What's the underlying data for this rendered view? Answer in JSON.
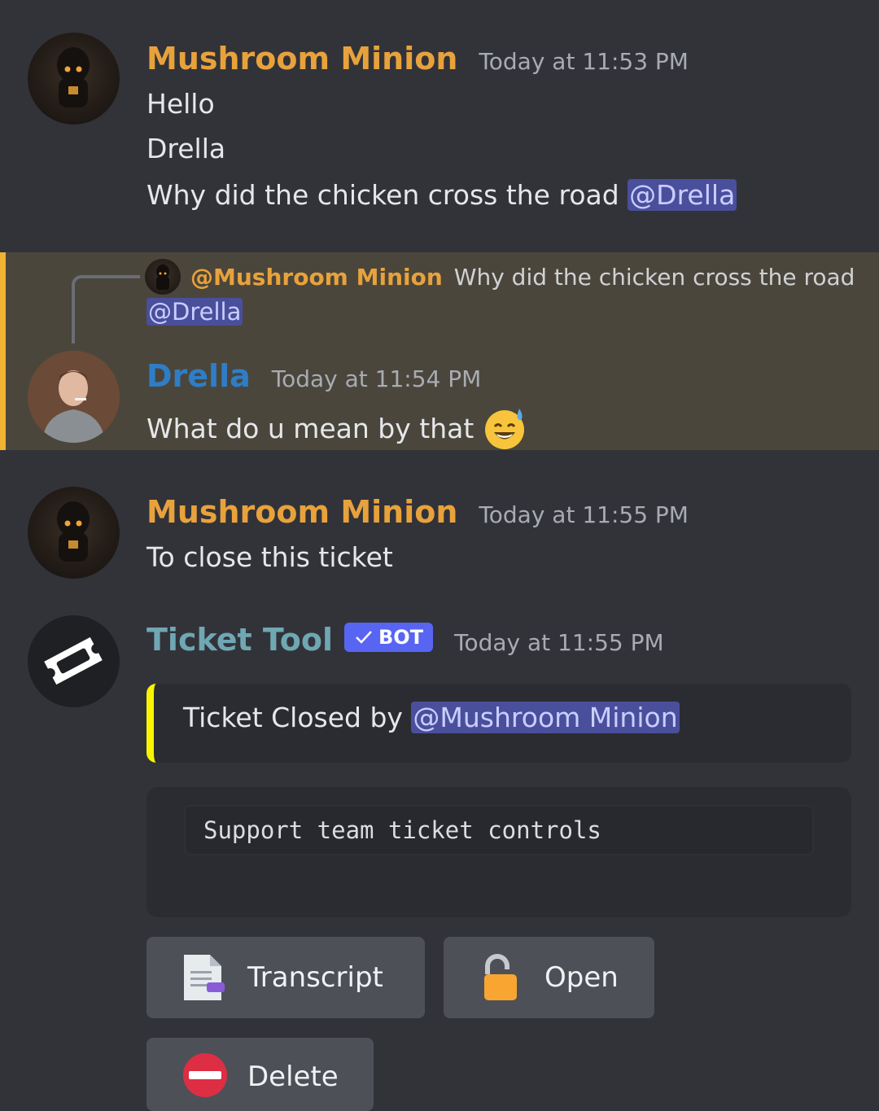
{
  "messages": [
    {
      "author": "Mushroom Minion",
      "timestamp": "Today at 11:53 PM",
      "lines": [
        "Hello",
        "Drella",
        "Why did the chicken cross the road "
      ],
      "mention": "@Drella"
    },
    {
      "reply": {
        "author": "@Mushroom Minion",
        "text": "Why did the chicken cross the road",
        "mention": "@Drella"
      },
      "author": "Drella",
      "timestamp": "Today at 11:54 PM",
      "text": "What do u mean by that",
      "emoji": "😅"
    },
    {
      "author": "Mushroom Minion",
      "timestamp": "Today at 11:55 PM",
      "text": "To close this ticket"
    },
    {
      "author": "Ticket Tool",
      "badge": "BOT",
      "timestamp": "Today at 11:55 PM",
      "embed": {
        "text": "Ticket Closed by ",
        "mention": "@Mushroom Minion"
      },
      "controls_code": "Support team ticket controls",
      "buttons": [
        {
          "label": "Transcript",
          "icon": "document-icon"
        },
        {
          "label": "Open",
          "icon": "unlock-icon"
        },
        {
          "label": "Delete",
          "icon": "no-entry-icon"
        }
      ]
    }
  ],
  "colors": {
    "background": "#323339",
    "highlight": "#4a463c",
    "highlight_bar": "#f0b232",
    "mention_bg": "#4a4f9c",
    "embed_bar": "#f8f400",
    "bot_badge": "#5865f2",
    "minion_name": "#e8a23c",
    "drella_name": "#2f7dc7",
    "tickettool_name": "#6fa7b3"
  }
}
